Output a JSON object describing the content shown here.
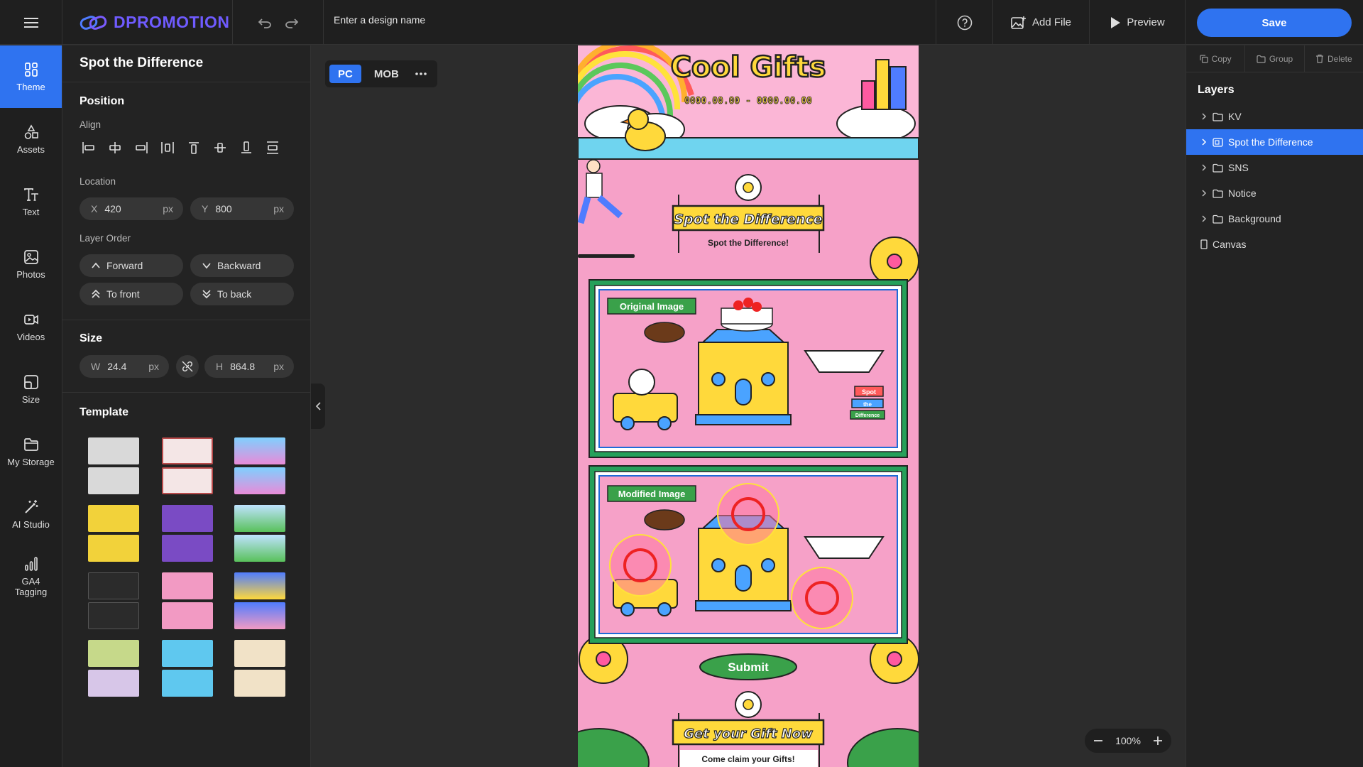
{
  "topbar": {
    "logo_text": "DPROMOTION",
    "design_name_placeholder": "Enter a design name",
    "add_file_label": "Add File",
    "preview_label": "Preview",
    "save_label": "Save"
  },
  "nav": {
    "items": [
      {
        "label": "Theme",
        "icon": "theme-icon"
      },
      {
        "label": "Assets",
        "icon": "assets-icon"
      },
      {
        "label": "Text",
        "icon": "text-icon"
      },
      {
        "label": "Photos",
        "icon": "photos-icon"
      },
      {
        "label": "Videos",
        "icon": "videos-icon"
      },
      {
        "label": "Size",
        "icon": "size-icon"
      },
      {
        "label": "My Storage",
        "icon": "folder-icon"
      },
      {
        "label": "AI Studio",
        "icon": "magic-wand-icon"
      },
      {
        "label": "GA4 Tagging",
        "icon": "bar-chart-icon"
      }
    ]
  },
  "panel": {
    "title": "Spot the Difference",
    "position_title": "Position",
    "align_label": "Align",
    "location_label": "Location",
    "location": {
      "x_label": "X",
      "x": "420",
      "y_label": "Y",
      "y": "800",
      "unit": "px"
    },
    "layer_order_label": "Layer Order",
    "layer_order": {
      "forward": "Forward",
      "backward": "Backward",
      "to_front": "To front",
      "to_back": "To back"
    },
    "size_title": "Size",
    "size": {
      "w_label": "W",
      "w": "24.4",
      "h_label": "H",
      "h": "864.8",
      "unit": "px"
    },
    "template_title": "Template"
  },
  "canvas": {
    "device_pc": "PC",
    "device_mob": "MOB",
    "zoom": "100%",
    "art": {
      "title": "Cool Gifts",
      "date": "0000.00.00 - 0000.00.00",
      "banner1_title": "Spot the Difference",
      "banner1_sub": "Spot the Difference!",
      "original_label": "Original Image",
      "modified_label": "Modified Image",
      "sign_top": "Spot",
      "sign_mid": "the",
      "sign_bottom": "Difference",
      "submit": "Submit",
      "banner2_title": "Get your Gift Now",
      "banner2_sub": "Come claim your Gifts!"
    }
  },
  "rpanel": {
    "copy": "Copy",
    "group": "Group",
    "delete": "Delete",
    "layers_title": "Layers",
    "layers": [
      {
        "label": "KV",
        "has_chevron": true,
        "icon": "folder-icon"
      },
      {
        "label": "Spot the Difference",
        "has_chevron": true,
        "icon": "component-icon",
        "active": true
      },
      {
        "label": "SNS",
        "has_chevron": true,
        "icon": "folder-icon"
      },
      {
        "label": "Notice",
        "has_chevron": true,
        "icon": "folder-icon"
      },
      {
        "label": "Background",
        "has_chevron": true,
        "icon": "folder-icon"
      },
      {
        "label": "Canvas",
        "has_chevron": false,
        "icon": "canvas-icon"
      }
    ]
  },
  "colors": {
    "accent": "#2f73f0",
    "art_pink": "#f6a1c8",
    "art_yellow": "#ffd93b",
    "art_green": "#3aa14a"
  }
}
